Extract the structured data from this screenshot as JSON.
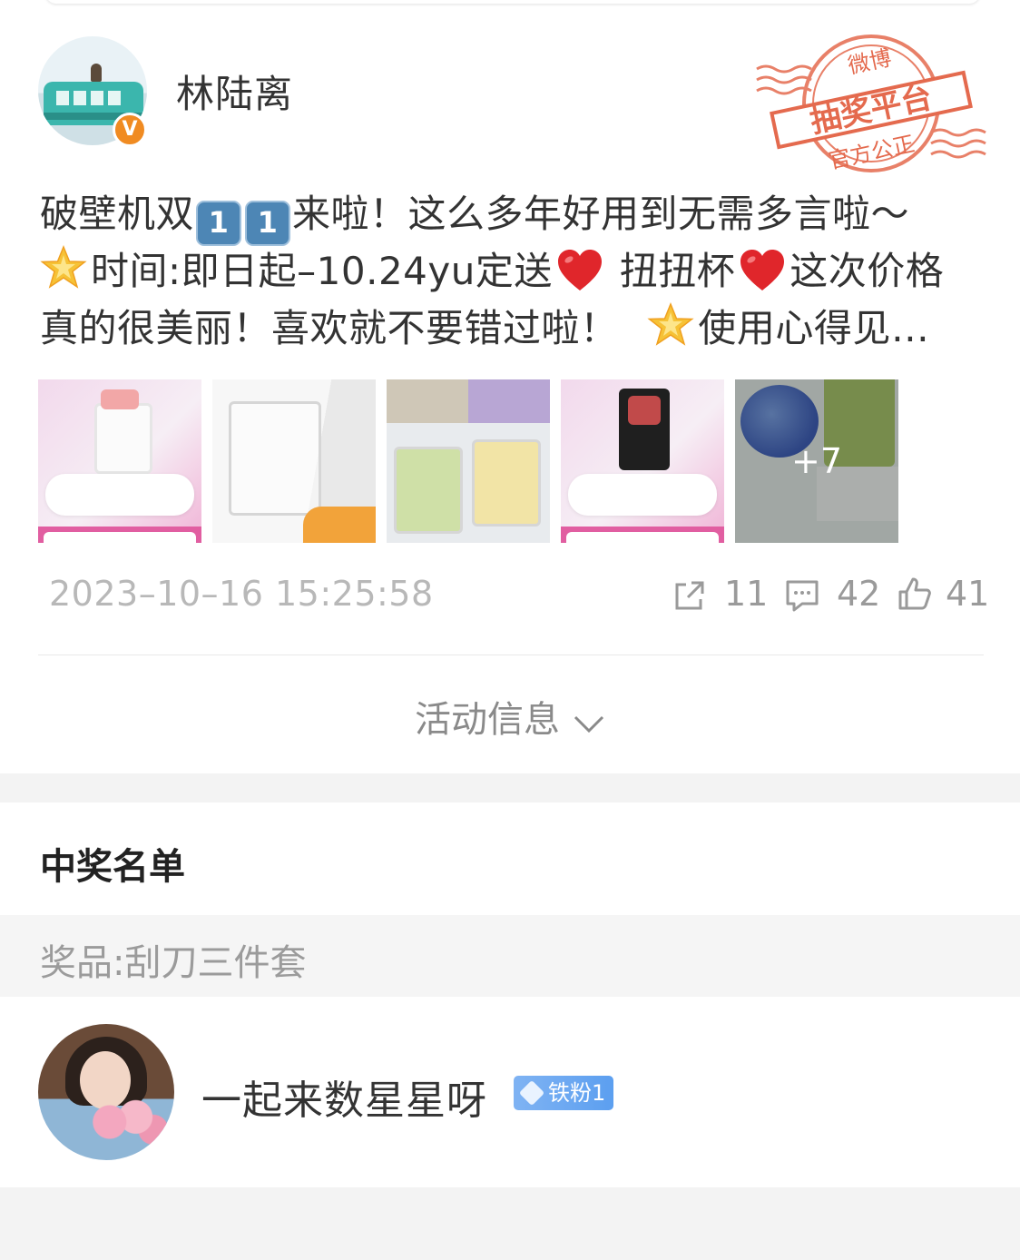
{
  "post": {
    "author": "林陆离",
    "stamp": {
      "top_text": "微博",
      "main_text": "抽奖平台",
      "bottom_text": "官方公正"
    },
    "text": {
      "line1_a": "破壁机双",
      "key": "1",
      "line1_b": "来啦！这么多年好用到无需多言啦～",
      "line2_a": "时间:即日起–10.24yu定送",
      "line2_b": "扭扭杯",
      "line2_c": "这次价格",
      "line3_a": "真的很美丽！喜欢就不要错过啦！",
      "line3_b": "使用心得见…"
    },
    "more_images": "+7",
    "timestamp": "2023–10–16 15:25:58",
    "reposts": "11",
    "comments": "42",
    "likes": "41"
  },
  "activity_label": "活动信息",
  "winners": {
    "title": "中奖名单",
    "prize": "奖品:刮刀三件套",
    "list": [
      {
        "name": "一起来数星星呀",
        "badge": "铁粉1"
      }
    ]
  },
  "colors": {
    "verified_orange": "#f08b22",
    "stamp_red": "#e46a4e",
    "badge_blue": "#5c9ff0",
    "heart_red": "#e0262b",
    "star_gold": "#f6c236"
  }
}
